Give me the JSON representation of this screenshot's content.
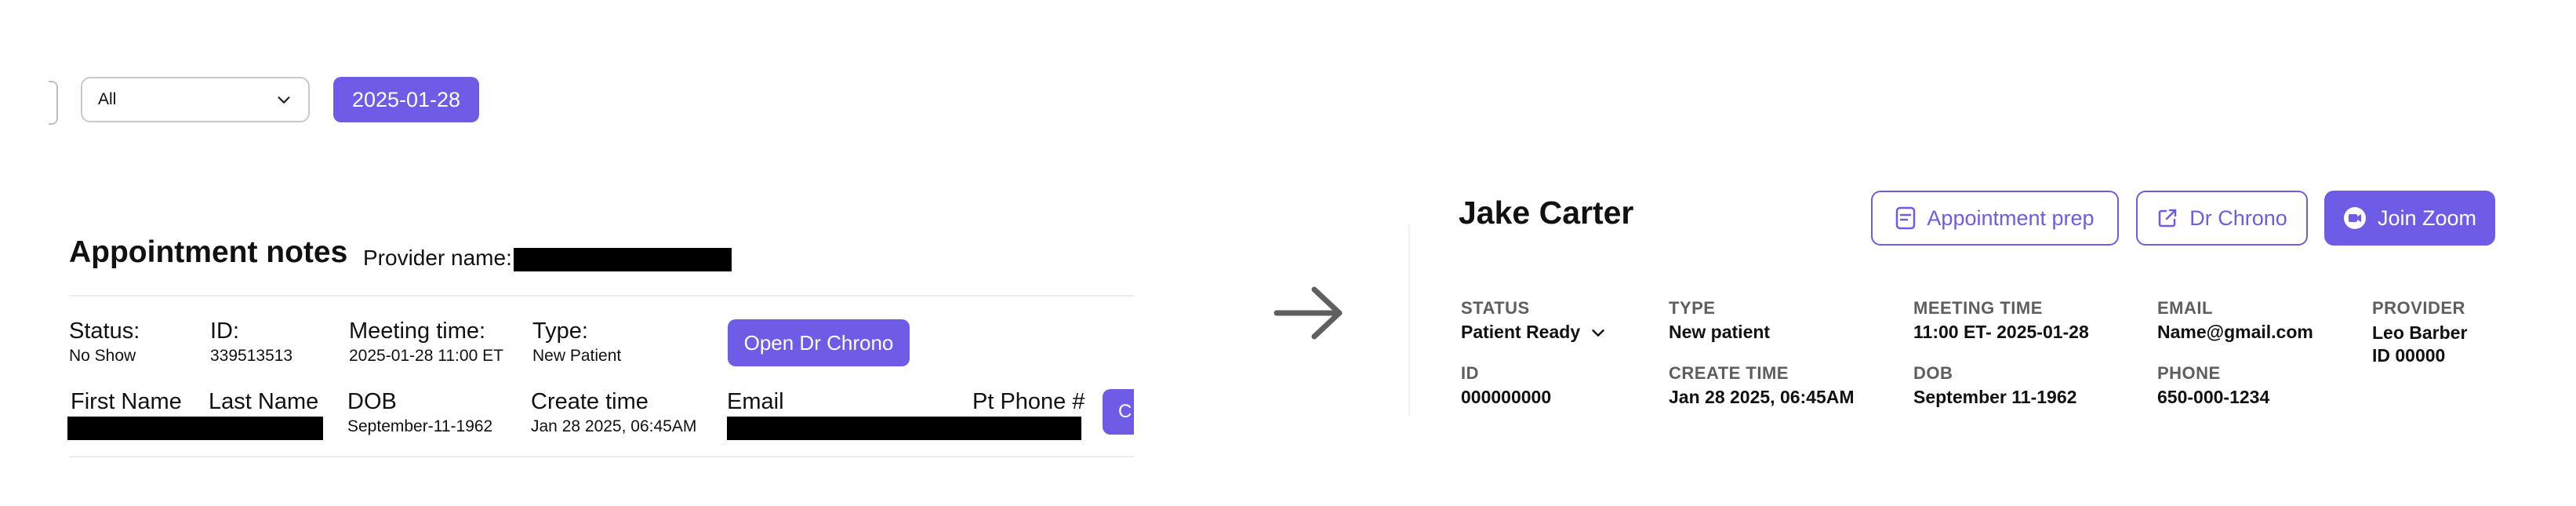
{
  "filter": {
    "value": "All"
  },
  "date_button": {
    "label": "2025-01-28"
  },
  "old_ui": {
    "title": "Appointment notes",
    "provider_label": "Provider name:",
    "fields": [
      {
        "label": "Status:",
        "value": "No Show"
      },
      {
        "label": "ID:",
        "value": "339513513"
      },
      {
        "label": "Meeting time:",
        "value": "2025-01-28 11:00 ET"
      },
      {
        "label": "Type:",
        "value": "New Patient"
      }
    ],
    "open_chrono_label": "Open Dr Chrono",
    "columns": {
      "first_name": "First Name",
      "last_name": "Last Name",
      "dob": {
        "label": "DOB",
        "value": "September-11-1962"
      },
      "create_time": {
        "label": "Create time",
        "value": "Jan 28 2025, 06:45AM"
      },
      "email": "Email",
      "phone": "Pt Phone #"
    },
    "cut_button_label": "C"
  },
  "new_ui": {
    "patient_name": "Jake Carter",
    "buttons": {
      "appointment_prep": "Appointment prep",
      "dr_chrono": "Dr Chrono",
      "join_zoom": "Join Zoom"
    },
    "status": {
      "label": "STATUS",
      "value": "Patient Ready"
    },
    "type": {
      "label": "TYPE",
      "value": "New patient"
    },
    "meeting_time": {
      "label": "MEETING TIME",
      "value": "11:00 ET- 2025-01-28"
    },
    "email": {
      "label": "EMAIL",
      "value": "Name@gmail.com"
    },
    "provider": {
      "label": "PROVIDER",
      "name": "Leo Barber",
      "id": "ID 00000"
    },
    "id": {
      "label": "ID",
      "value": "000000000"
    },
    "create_time": {
      "label": "CREATE TIME",
      "value": "Jan 28 2025, 06:45AM"
    },
    "dob": {
      "label": "DOB",
      "value": "September 11-1962"
    },
    "phone": {
      "label": "PHONE",
      "value": "650-000-1234"
    }
  },
  "colors": {
    "accent": "#6e5ce6",
    "label_gray": "#5e5e5e",
    "redaction": "#000000"
  },
  "icons": [
    "chevron-down-icon",
    "arrow-right-icon",
    "document-icon",
    "external-link-icon",
    "video-camera-icon"
  ]
}
